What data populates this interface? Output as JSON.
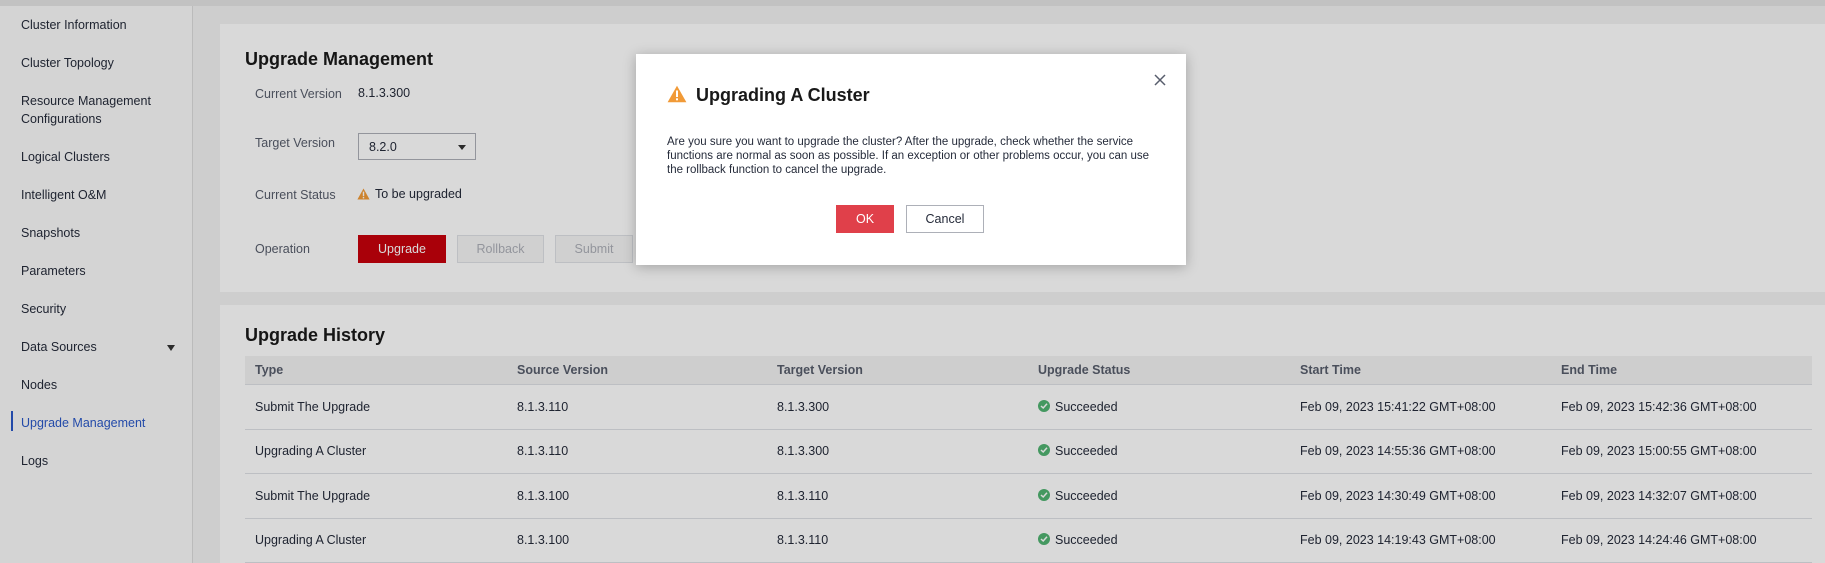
{
  "sidebar": {
    "items": [
      {
        "label": "Cluster Information"
      },
      {
        "label": "Cluster Topology"
      },
      {
        "label": "Resource Management\nConfigurations"
      },
      {
        "label": "Logical Clusters"
      },
      {
        "label": "Intelligent O&M"
      },
      {
        "label": "Snapshots"
      },
      {
        "label": "Parameters"
      },
      {
        "label": "Security"
      },
      {
        "label": "Data Sources"
      },
      {
        "label": "Nodes"
      },
      {
        "label": "Upgrade Management"
      },
      {
        "label": "Logs"
      }
    ],
    "active": "Upgrade Management"
  },
  "upgrade_management": {
    "title": "Upgrade Management",
    "current_version_label": "Current Version",
    "current_version": "8.1.3.300",
    "target_version_label": "Target Version",
    "target_version": "8.2.0",
    "current_status_label": "Current Status",
    "current_status": "To be upgraded",
    "operation_label": "Operation",
    "buttons": {
      "upgrade": "Upgrade",
      "rollback": "Rollback",
      "submit": "Submit"
    }
  },
  "upgrade_history": {
    "title": "Upgrade History",
    "columns": [
      "Type",
      "Source Version",
      "Target Version",
      "Upgrade Status",
      "Start Time",
      "End Time"
    ],
    "rows": [
      {
        "type": "Submit The Upgrade",
        "source": "8.1.3.110",
        "target": "8.1.3.300",
        "status": "Succeeded",
        "start": "Feb 09, 2023 15:41:22 GMT+08:00",
        "end": "Feb 09, 2023 15:42:36 GMT+08:00"
      },
      {
        "type": "Upgrading A Cluster",
        "source": "8.1.3.110",
        "target": "8.1.3.300",
        "status": "Succeeded",
        "start": "Feb 09, 2023 14:55:36 GMT+08:00",
        "end": "Feb 09, 2023 15:00:55 GMT+08:00"
      },
      {
        "type": "Submit The Upgrade",
        "source": "8.1.3.100",
        "target": "8.1.3.110",
        "status": "Succeeded",
        "start": "Feb 09, 2023 14:30:49 GMT+08:00",
        "end": "Feb 09, 2023 14:32:07 GMT+08:00"
      },
      {
        "type": "Upgrading A Cluster",
        "source": "8.1.3.100",
        "target": "8.1.3.110",
        "status": "Succeeded",
        "start": "Feb 09, 2023 14:19:43 GMT+08:00",
        "end": "Feb 09, 2023 14:24:46 GMT+08:00"
      }
    ]
  },
  "dialog": {
    "title": "Upgrading A Cluster",
    "message": "Are you sure you want to upgrade the cluster? After the upgrade, check whether the service functions are normal as soon as possible. If an exception or other problems occur, you can use the rollback function to cancel the upgrade.",
    "ok": "OK",
    "cancel": "Cancel"
  },
  "colors": {
    "primary_red": "#c7000b",
    "ok_red": "#e0404a",
    "warning_orange": "#f19a37",
    "success_green": "#50b371",
    "active_link": "#2a58c7"
  }
}
